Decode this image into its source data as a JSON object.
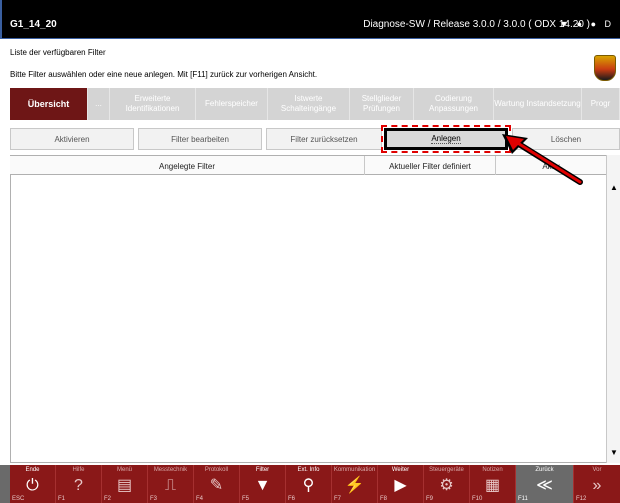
{
  "window": {
    "title_left": "G1_14_20",
    "title_right": "Diagnose-SW / Release 3.0.0 / 3.0.0 ( ODX  14.20 )",
    "title_icons": "▼ ● ● D"
  },
  "header": {
    "line1": "Liste der verfügbaren Filter",
    "line2": "Bitte Filter auswählen oder eine neue anlegen. Mit [F11] zurück zur vorherigen Ansicht."
  },
  "tabs": [
    {
      "label": "Übersicht"
    },
    {
      "label": "..."
    },
    {
      "label": "Erweiterte Identifikationen"
    },
    {
      "label": "Fehlerspeicher"
    },
    {
      "label": "Istwerte Schalteingänge"
    },
    {
      "label": "Stellglieder Prüfungen"
    },
    {
      "label": "Codierung Anpassungen"
    },
    {
      "label": "Wartung Instandsetzung"
    },
    {
      "label": "Progr"
    }
  ],
  "actions": {
    "aktivieren": "Aktivieren",
    "bearbeiten": "Filter bearbeiten",
    "zuruecksetzen": "Filter zurücksetzen",
    "anlegen": "Anlegen",
    "loeschen": "Löschen"
  },
  "table": {
    "columns": [
      "Angelegte Filter",
      "Aktueller Filter definiert",
      "Aktiv"
    ]
  },
  "fkeys": [
    {
      "label": "Ende",
      "glyph": "⏻",
      "num": "ESC"
    },
    {
      "label": "Hilfe",
      "glyph": "?",
      "num": "F1"
    },
    {
      "label": "Menü",
      "glyph": "▤",
      "num": "F2"
    },
    {
      "label": "Messtechnik",
      "glyph": "⎍",
      "num": "F3"
    },
    {
      "label": "Protokoll",
      "glyph": "✎",
      "num": "F4"
    },
    {
      "label": "Filter",
      "glyph": "▼",
      "num": "F5"
    },
    {
      "label": "Ext. Info",
      "glyph": "⚲",
      "num": "F6"
    },
    {
      "label": "Kommunikation",
      "glyph": "⚡",
      "num": "F7"
    },
    {
      "label": "Weiter",
      "glyph": "▶",
      "num": "F8"
    },
    {
      "label": "Steuergeräte",
      "glyph": "⚙",
      "num": "F9"
    },
    {
      "label": "Notizen",
      "glyph": "▦",
      "num": "F10"
    },
    {
      "label": "Zurück",
      "glyph": "≪",
      "num": "F11"
    },
    {
      "label": "Vor",
      "glyph": "»",
      "num": "F12"
    }
  ],
  "colors": {
    "title_bar": "#000000",
    "tab_active": "#6e1616",
    "bottom_bar": "#8a1818",
    "highlight": "#e00000"
  }
}
